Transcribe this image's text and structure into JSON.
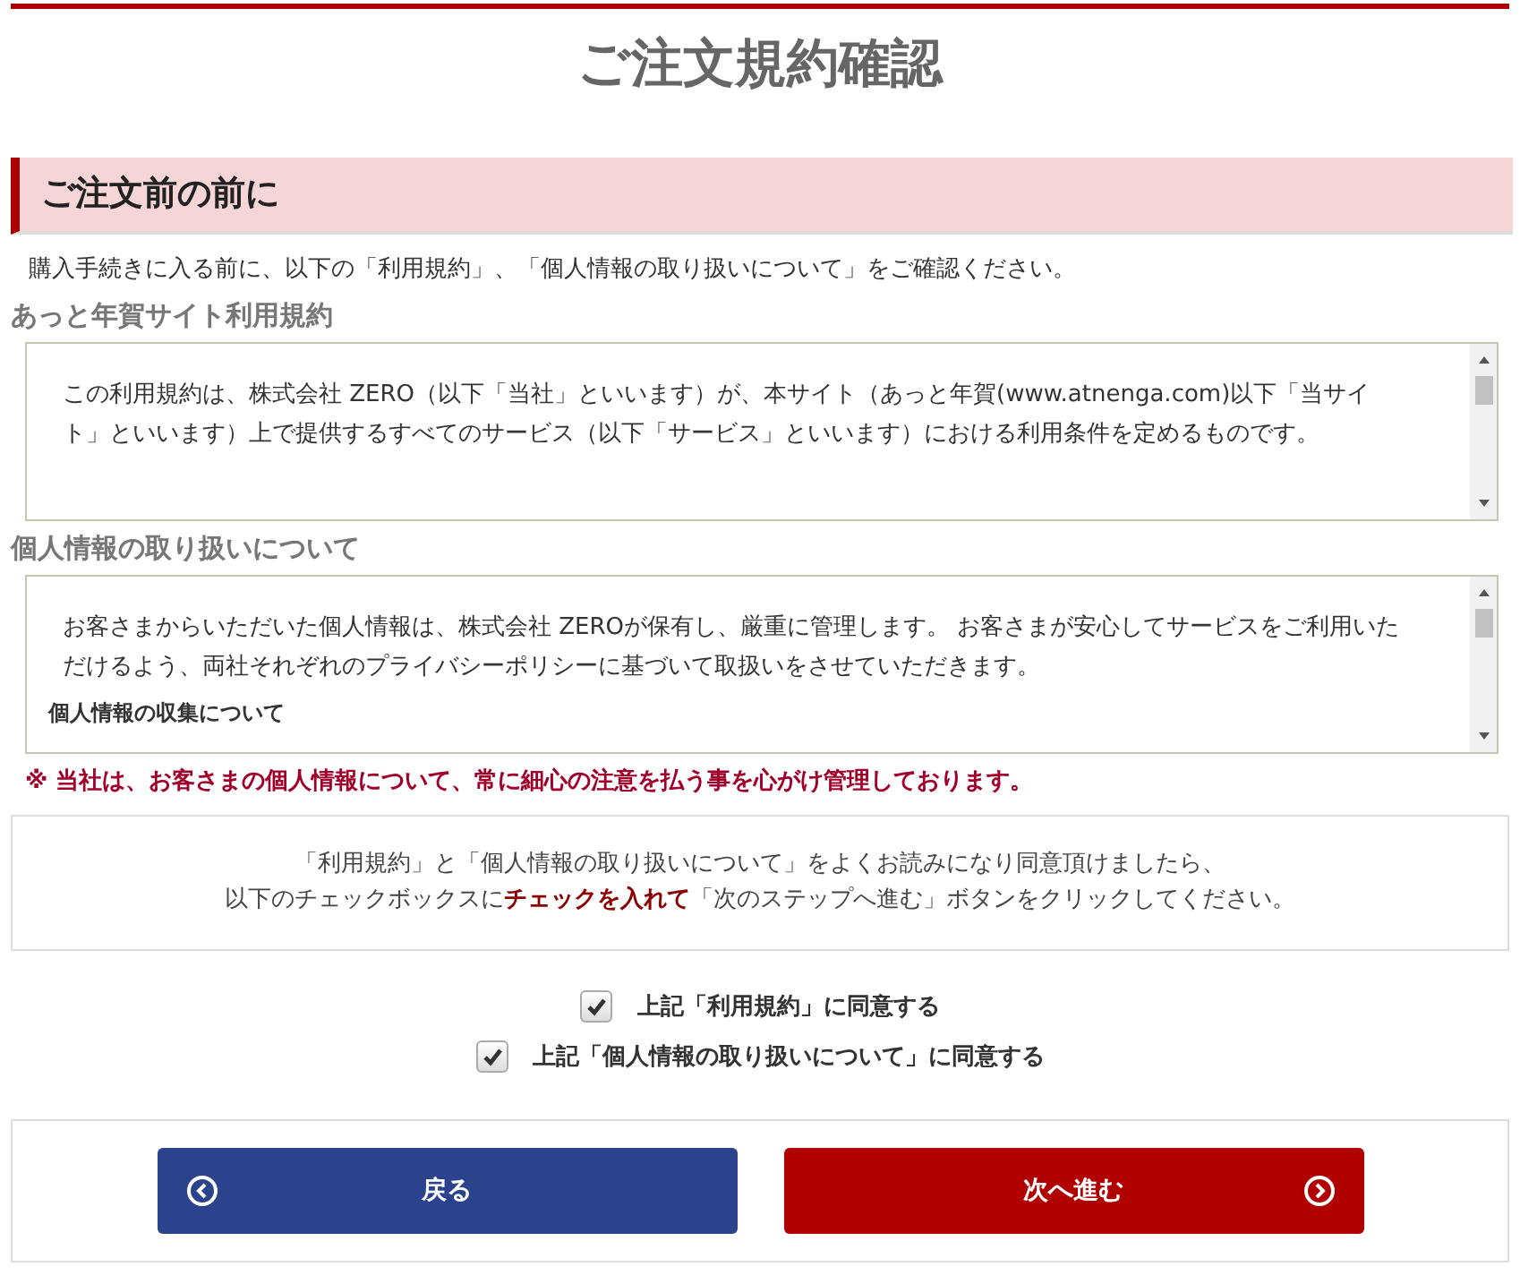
{
  "page_title": "ご注文規約確認",
  "section": {
    "heading": "ご注文前の前に",
    "intro": "購入手続きに入る前に、以下の「利用規約」、「個人情報の取り扱いについて」をご確認ください。"
  },
  "documents": [
    {
      "title": "あっと年賀サイト利用規約",
      "paragraphs": [
        "この利用規約は、株式会社 ZERO（以下「当社」といいます）が、本サイト（あっと年賀(www.atnenga.com)以下「当サイト」といいます）上で提供するすべてのサービス（以下「サービス」といいます）における利用条件を定めるものです。"
      ]
    },
    {
      "title": "個人情報の取り扱いについて",
      "paragraphs": [
        "お客さまからいただいた個人情報は、株式会社 ZEROが保有し、厳重に管理します。 お客さまが安心してサービスをご利用いただけるよう、両社それぞれのプライバシーポリシーに基づいて取扱いをさせていただきます。"
      ],
      "subheading": "個人情報の収集について"
    }
  ],
  "warning": "※ 当社は、お客さまの個人情報について、常に細心の注意を払う事を心がけ管理しております。",
  "notice": [
    "「利用規約」と「個人情報の取り扱いについて」をよくお読みになり同意頂けましたら、",
    "以下のチェックボックスに**チェックを入れて**「次のステップへ進む」ボタンをクリックしてください。"
  ],
  "agreements": [
    {
      "label": "上記「利用規約」に同意する",
      "checked": true
    },
    {
      "label": "上記「個人情報の取り扱いについて」に同意する",
      "checked": true
    }
  ],
  "buttons": [
    {
      "label": "戻る",
      "kind": "back"
    },
    {
      "label": "次へ進む",
      "kind": "next"
    }
  ]
}
